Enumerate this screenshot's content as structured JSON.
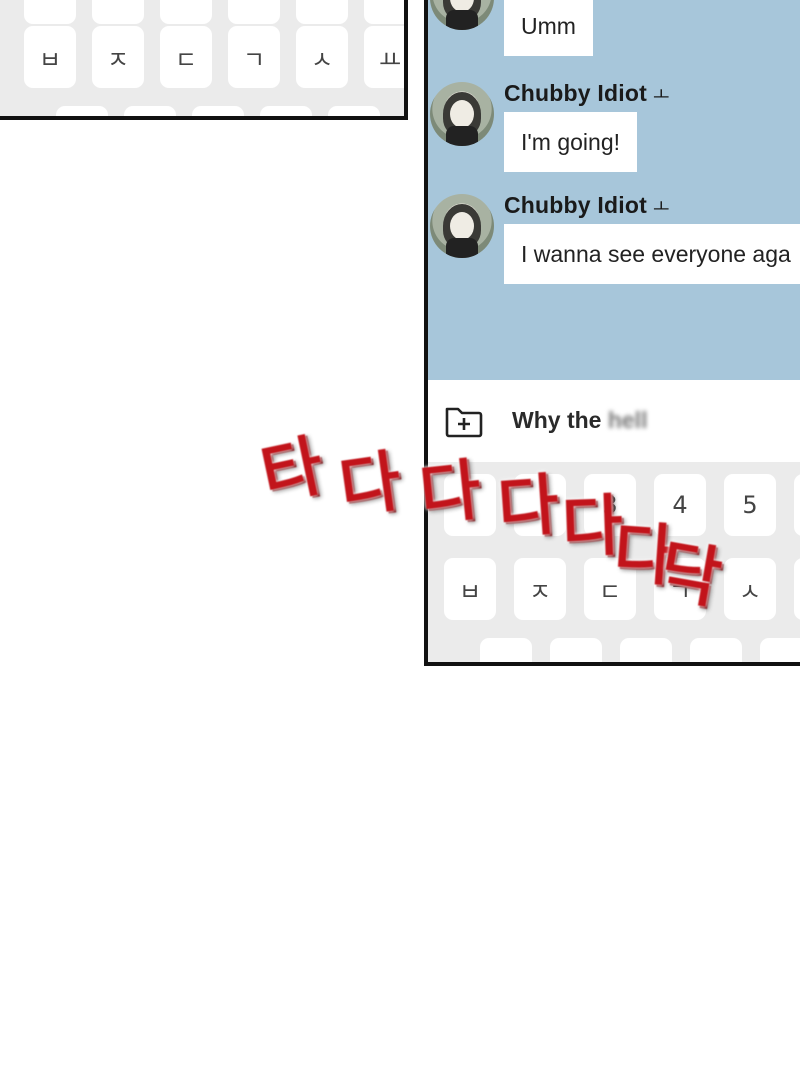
{
  "panel_top_keyboard": {
    "row_keys": [
      "ㅂ",
      "ㅈ",
      "ㄷ",
      "ㄱ",
      "ㅅ",
      "ㅛ"
    ]
  },
  "chat": {
    "background_color": "#a7c6da",
    "messages": [
      {
        "sender": "",
        "text": "Umm"
      },
      {
        "sender": "Chubby Idiot",
        "sender_mark": "ㅗ",
        "text": "I'm going!"
      },
      {
        "sender": "Chubby Idiot",
        "sender_mark": "ㅗ",
        "text": "I wanna see everyone aga"
      }
    ]
  },
  "input_bar": {
    "icon": "folder-plus-icon",
    "text_visible": "Why the",
    "text_blurred": "hell"
  },
  "keyboard": {
    "number_row": [
      "3",
      "4",
      "5"
    ],
    "letter_row": [
      "ㅂ",
      "ㅈ",
      "ㄷ",
      "ㄱ",
      "ㅅ",
      "ㅛ"
    ]
  },
  "sound_effect": {
    "chars": [
      "타",
      "다",
      "다",
      "다",
      "다",
      "다",
      "닥"
    ],
    "color": "#c2141b"
  }
}
